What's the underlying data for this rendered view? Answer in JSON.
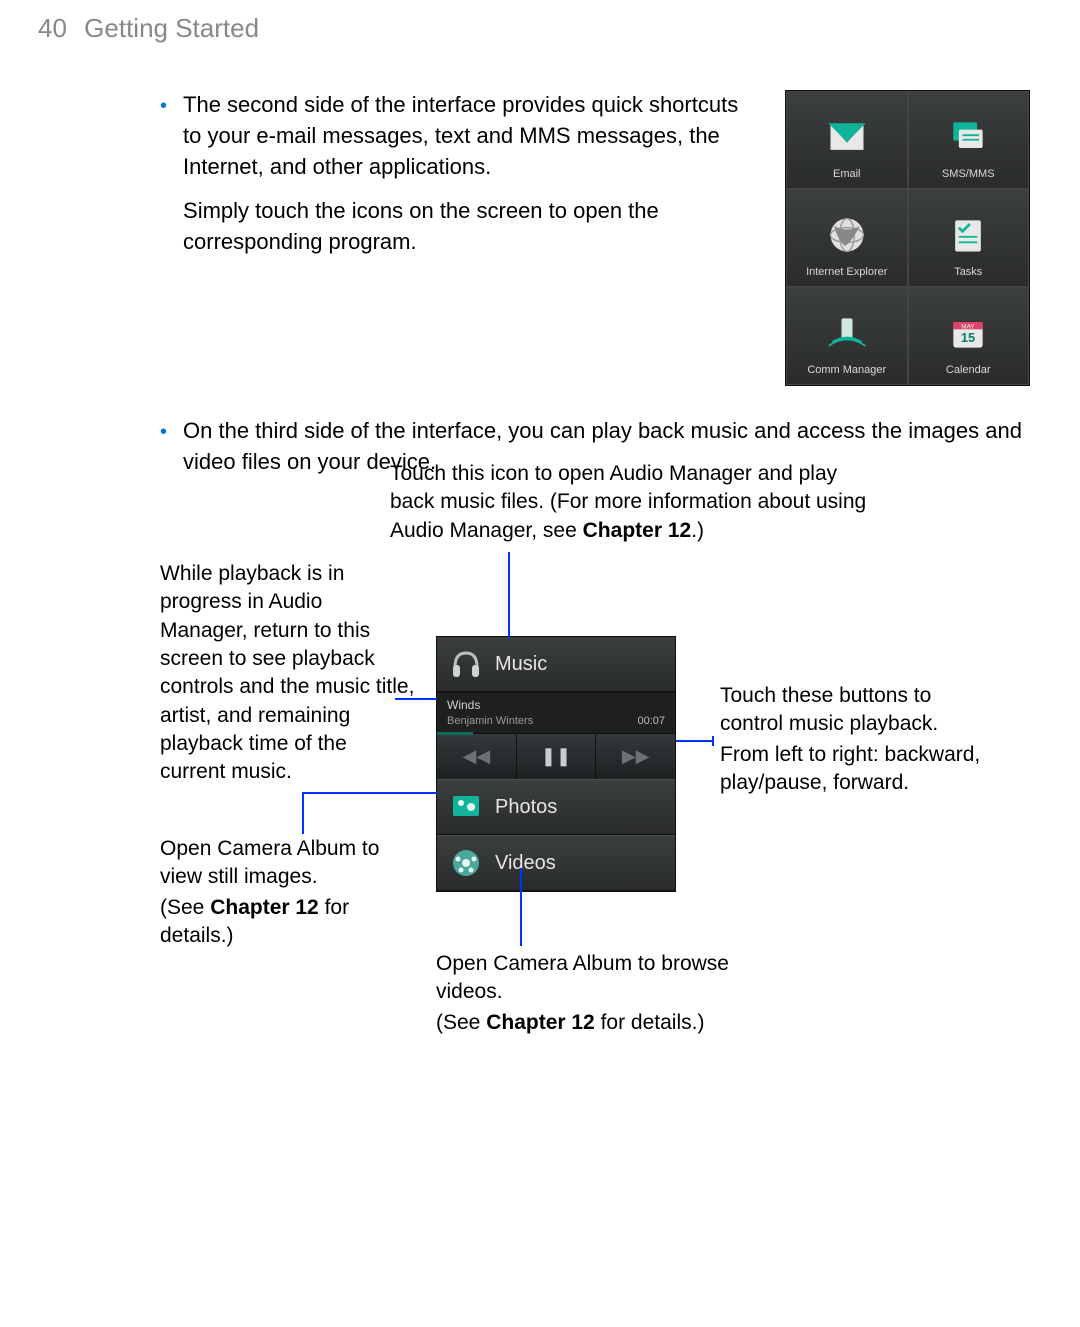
{
  "header": {
    "page_number": "40",
    "title": "Getting Started"
  },
  "bullets": {
    "b1_p1": "The second side of the interface provides quick shortcuts to your e-mail messages, text and MMS messages, the Internet, and other applications.",
    "b1_p2": "Simply touch the icons on the screen to open the corresponding program.",
    "b2": "On the third side of the interface, you can play back music and access the images and video files on your device."
  },
  "shortcuts": {
    "email": "Email",
    "sms": "SMS/MMS",
    "ie": "Internet Explorer",
    "tasks": "Tasks",
    "comm": "Comm Manager",
    "calendar": "Calendar",
    "cal_month": "MAY",
    "cal_day": "15"
  },
  "media": {
    "music_label": "Music",
    "photos_label": "Photos",
    "videos_label": "Videos",
    "track_title": "Winds",
    "track_artist": "Benjamin Winters",
    "track_time": "00:07"
  },
  "captions": {
    "top_pre": "Touch this icon to open Audio Manager and play back music files. (For more information about using Audio Manager, see ",
    "top_ch": "Chapter 12",
    "top_post": ".)",
    "left1": "While playback is in progress in Audio Manager, return to this screen to see playback controls and the music title, artist, and remaining playback time of the current music.",
    "right_l1": "Touch these buttons to control music playback.",
    "right_l2": "From left to right: backward, play/pause, forward.",
    "photos_pre": "Open Camera Album to view still images.",
    "photos_see1": "(See ",
    "photos_ch": "Chapter 12",
    "photos_see2": " for details.)",
    "videos_pre": "Open Camera Album to browse videos.",
    "videos_see1": "(See ",
    "videos_ch": "Chapter 12",
    "videos_see2": " for details.)"
  }
}
